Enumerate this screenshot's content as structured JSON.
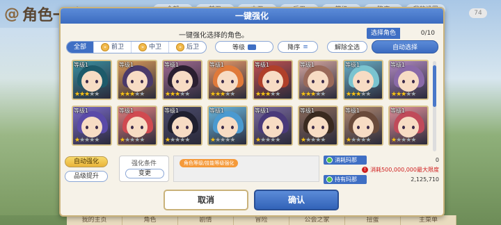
{
  "background": {
    "title": "角色一览",
    "topbar": [
      "全部",
      "前卫",
      "中卫",
      "后卫",
      "等级",
      "降序",
      "我的设置"
    ],
    "badge": "74",
    "bottom_nav": [
      "我的主页",
      "角色",
      "剧情",
      "冒险",
      "公会之家",
      "扭蛋",
      "主菜单"
    ]
  },
  "dialog": {
    "title": "一键强化",
    "subtitle": "一键强化选择的角色。",
    "select_label": "选择角色",
    "select_count": "0/10"
  },
  "filters": {
    "tabs": [
      {
        "label": "全部",
        "active": true
      },
      {
        "label": "前卫",
        "active": false
      },
      {
        "label": "中卫",
        "active": false
      },
      {
        "label": "后卫",
        "active": false
      }
    ],
    "sort_key": "等级",
    "sort_order": "降序",
    "deselect_all": "解除全选",
    "auto_select": "自动选择"
  },
  "characters": [
    {
      "level": "等级1",
      "stars": 3,
      "color": "#3a8fa0",
      "hair": "#1d5a6a"
    },
    {
      "level": "等级1",
      "stars": 3,
      "color": "#d99a5a",
      "hair": "#4a3a6a"
    },
    {
      "level": "等级1",
      "stars": 3,
      "color": "#a06a90",
      "hair": "#2a1f30"
    },
    {
      "level": "等级1",
      "stars": 3,
      "color": "#e89a6a",
      "hair": "#e07a3a"
    },
    {
      "level": "等级1",
      "stars": 3,
      "color": "#c05050",
      "hair": "#b0402a"
    },
    {
      "level": "等级1",
      "stars": 3,
      "color": "#d6a7a0",
      "hair": "#9a6a5a"
    },
    {
      "level": "等级1",
      "stars": 3,
      "color": "#6ab0c8",
      "hair": "#7ac4d0"
    },
    {
      "level": "等级1",
      "stars": 3,
      "color": "#b089c0",
      "hair": "#8a6aa8"
    },
    {
      "level": "等级1",
      "stars": 1,
      "color": "#7a6ac8",
      "hair": "#5a4aa8"
    },
    {
      "level": "等级1",
      "stars": 1,
      "color": "#e08080",
      "hair": "#d04a50"
    },
    {
      "level": "等级1",
      "stars": 1,
      "color": "#4a4a6a",
      "hair": "#1f1f2f"
    },
    {
      "level": "等级1",
      "stars": 1,
      "color": "#6ab8e0",
      "hair": "#4a9ad0"
    },
    {
      "level": "等级1",
      "stars": 1,
      "color": "#7a6aa0",
      "hair": "#4a3a7a"
    },
    {
      "level": "等级1",
      "stars": 1,
      "color": "#8a6a5a",
      "hair": "#3a2a20"
    },
    {
      "level": "等级1",
      "stars": 1,
      "color": "#b08870",
      "hair": "#6a4a3a"
    },
    {
      "level": "等级1",
      "stars": 1,
      "color": "#e0909a",
      "hair": "#c04a5a"
    }
  ],
  "panel": {
    "auto_enhance": "自动强化",
    "rank_up": "品级提升",
    "condition_title": "强化条件",
    "change": "变更",
    "condition_tag": "角色等级/技能等级强化",
    "consume_label": "消耗玛那",
    "consume_value": "0",
    "warning": "消耗500,000,000最大限度",
    "owned_label": "持有玛那",
    "owned_value": "2,125,710"
  },
  "actions": {
    "cancel": "取消",
    "confirm": "确认"
  },
  "colors": {
    "accent": "#3f6fc4",
    "gold": "#f5c21b",
    "warning": "#d02020",
    "tag": "#f59a3a"
  }
}
